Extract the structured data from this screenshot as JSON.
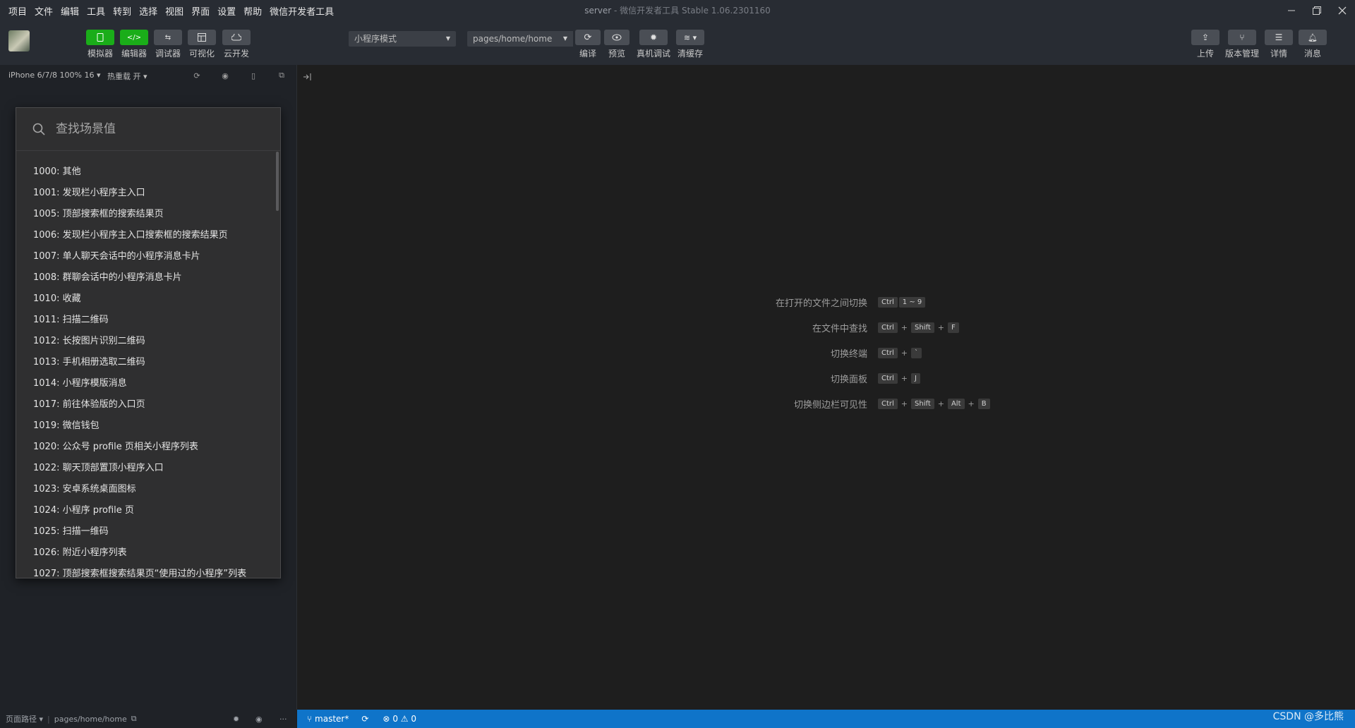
{
  "menu": [
    "项目",
    "文件",
    "编辑",
    "工具",
    "转到",
    "选择",
    "视图",
    "界面",
    "设置",
    "帮助",
    "微信开发者工具"
  ],
  "window": {
    "title": "server",
    "subtitle": "微信开发者工具 Stable 1.06.2301160"
  },
  "toolbar": {
    "simulator": "模拟器",
    "editor": "编辑器",
    "debugger": "调试器",
    "visual": "可视化",
    "cloud": "云开发",
    "mode_select": "小程序模式",
    "page_select": "pages/home/home",
    "compile": "编译",
    "preview": "预览",
    "real_debug": "真机调试",
    "clear_cache": "清缓存",
    "upload": "上传",
    "version": "版本管理",
    "details": "详情",
    "messages": "消息",
    "accent_color": "#1aad19"
  },
  "sim": {
    "device": "iPhone 6/7/8 100% 16",
    "hot_reload": "热重载 开",
    "search_placeholder": "查找场景值",
    "scenes": [
      "1000: 其他",
      "1001: 发现栏小程序主入口",
      "1005: 顶部搜索框的搜索结果页",
      "1006: 发现栏小程序主入口搜索框的搜索结果页",
      "1007: 单人聊天会话中的小程序消息卡片",
      "1008: 群聊会话中的小程序消息卡片",
      "1010: 收藏",
      "1011: 扫描二维码",
      "1012: 长按图片识别二维码",
      "1013: 手机相册选取二维码",
      "1014: 小程序模版消息",
      "1017: 前往体验版的入口页",
      "1019: 微信钱包",
      "1020: 公众号 profile 页相关小程序列表",
      "1022: 聊天顶部置顶小程序入口",
      "1023: 安卓系统桌面图标",
      "1024: 小程序 profile 页",
      "1025: 扫描一维码",
      "1026: 附近小程序列表",
      "1027: 顶部搜索框搜索结果页“使用过的小程序”列表"
    ],
    "footer_path_label": "页面路径",
    "footer_path": "pages/home/home"
  },
  "shortcuts": [
    {
      "label": "在打开的文件之间切换",
      "keys": [
        "Ctrl",
        "1 ~ 9"
      ],
      "sep": ""
    },
    {
      "label": "在文件中查找",
      "keys": [
        "Ctrl",
        "Shift",
        "F"
      ],
      "sep": "+"
    },
    {
      "label": "切换终端",
      "keys": [
        "Ctrl",
        "`"
      ],
      "sep": "+"
    },
    {
      "label": "切换面板",
      "keys": [
        "Ctrl",
        "J"
      ],
      "sep": "+"
    },
    {
      "label": "切换侧边栏可见性",
      "keys": [
        "Ctrl",
        "Shift",
        "Alt",
        "B"
      ],
      "sep": "+"
    }
  ],
  "status": {
    "branch": "master*",
    "errors": "0",
    "warnings": "0",
    "statusbar_color": "#0f74c9"
  },
  "watermark": "CSDN @多比熊"
}
